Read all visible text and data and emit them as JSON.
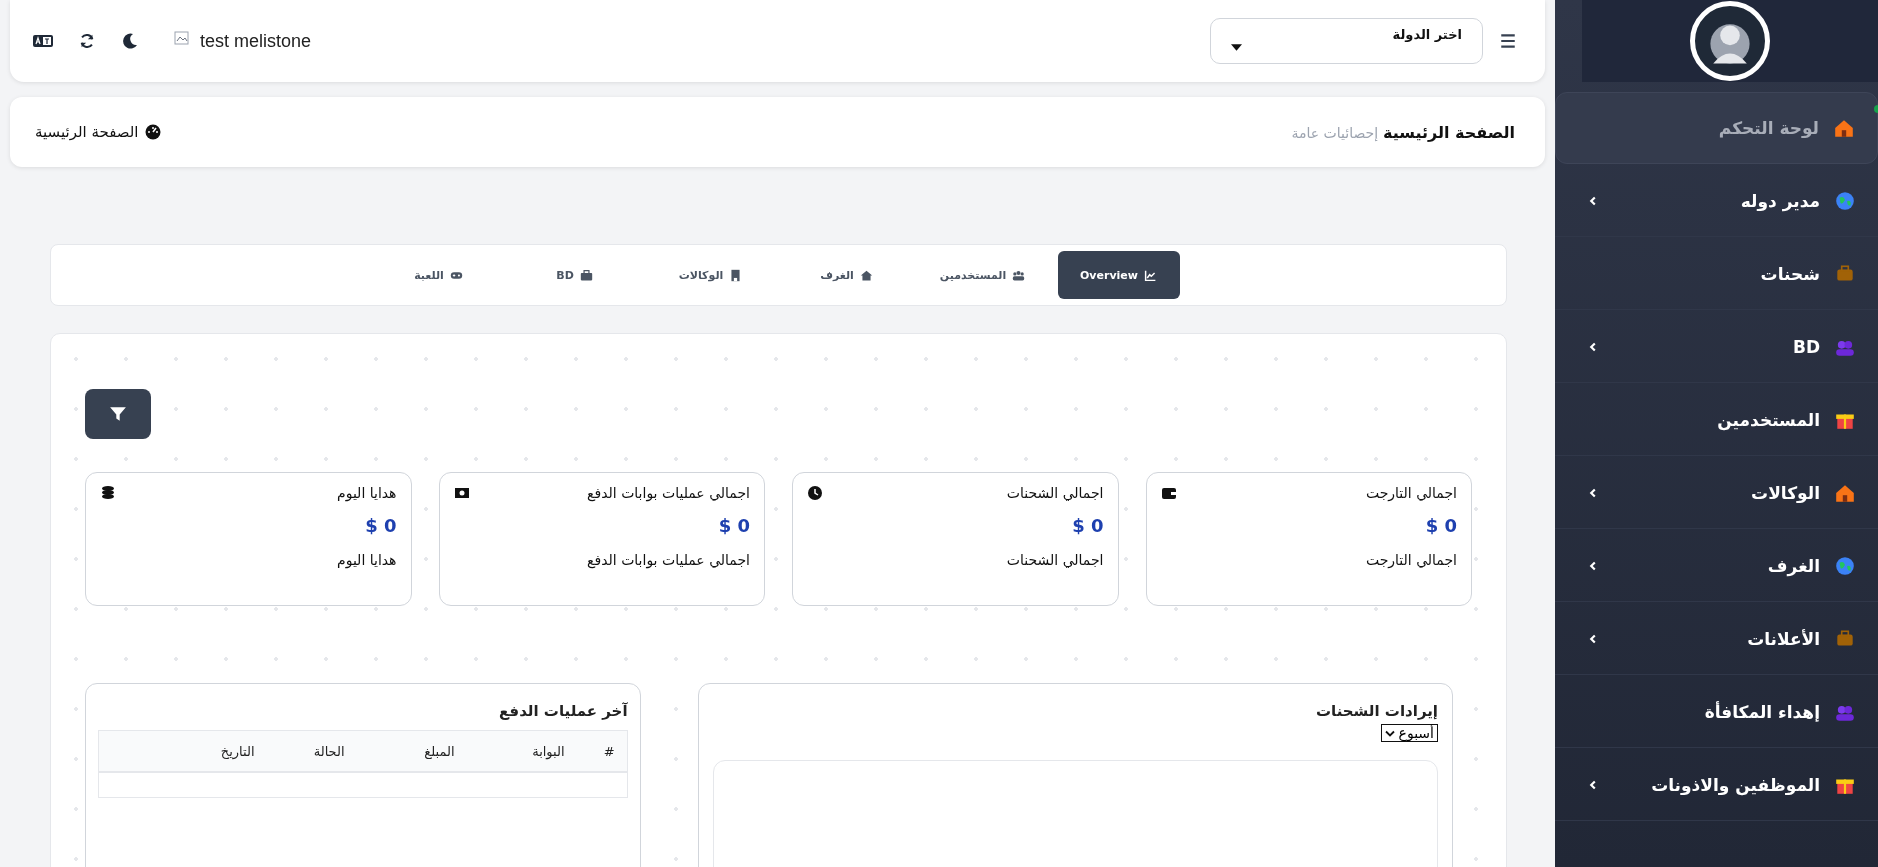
{
  "topbar": {
    "country_select": {
      "placeholder": "اختر الدولة"
    },
    "brand": "test melistone"
  },
  "breadcrumb": {
    "current": "الصفحة الرئيسية",
    "subtitle": "إحصائيات عامة",
    "home_link": "الصفحة الرئيسية"
  },
  "tabs": [
    {
      "label": "Overview",
      "selected": true
    },
    {
      "label": "المستخدمين",
      "selected": false
    },
    {
      "label": "الغرف",
      "selected": false
    },
    {
      "label": "الوكالات",
      "selected": false
    },
    {
      "label": "BD",
      "selected": false
    },
    {
      "label": "اللعبة",
      "selected": false
    }
  ],
  "stats": [
    {
      "title": "اجمالي التارجت",
      "value": "$ 0",
      "footer": "اجمالي التارجت"
    },
    {
      "title": "اجمالي الشحنات",
      "value": "$ 0",
      "footer": "اجمالي الشحنات"
    },
    {
      "title": "اجمالي عمليات بوابات الدفع",
      "value": "$ 0",
      "footer": "اجمالي عمليات بوابات الدفع"
    },
    {
      "title": "هدايا اليوم",
      "value": "$ 0",
      "footer": "هدايا اليوم"
    }
  ],
  "revenue_panel": {
    "title": "إيرادات الشحنات",
    "period": "أسبوع"
  },
  "payments_panel": {
    "title": "آخر عمليات الدفع",
    "columns": [
      "#",
      "البوابة",
      "المبلغ",
      "الحالة",
      "التاريخ"
    ]
  },
  "sidebar": {
    "items": [
      {
        "label": "لوحة التحكم",
        "selected": true,
        "has_submenu": false
      },
      {
        "label": "مدير دوله",
        "selected": false,
        "has_submenu": true
      },
      {
        "label": "شحنات",
        "selected": false,
        "has_submenu": false
      },
      {
        "label": "BD",
        "selected": false,
        "has_submenu": true
      },
      {
        "label": "المستخدمين",
        "selected": false,
        "has_submenu": false
      },
      {
        "label": "الوكالات",
        "selected": false,
        "has_submenu": true
      },
      {
        "label": "الغرف",
        "selected": false,
        "has_submenu": true
      },
      {
        "label": "الأعلانات",
        "selected": false,
        "has_submenu": true
      },
      {
        "label": "إهداء المكافأة",
        "selected": false,
        "has_submenu": false
      },
      {
        "label": "الموظفين والاذونات",
        "selected": false,
        "has_submenu": true
      }
    ]
  }
}
